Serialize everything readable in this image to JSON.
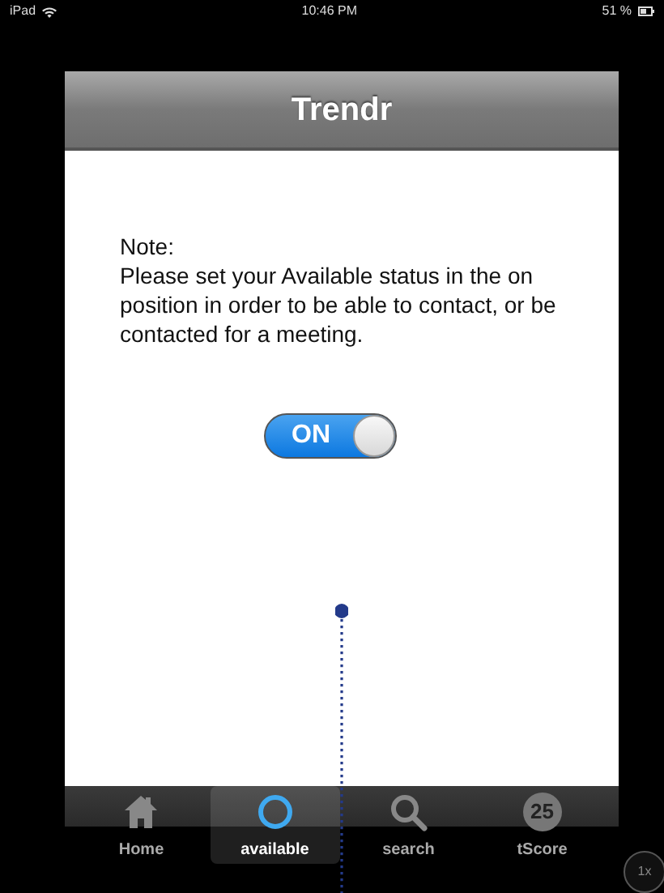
{
  "status_bar": {
    "carrier": "iPad",
    "time": "10:46 PM",
    "battery": "51 %"
  },
  "navbar": {
    "title": "Trendr"
  },
  "note": {
    "heading": "Note:",
    "text": "Please set your Available status in the on position in order to be able to contact, or be contacted for a meeting."
  },
  "switch": {
    "label": "ON",
    "on": true
  },
  "tabs": [
    {
      "kind": "home",
      "label": "Home",
      "selected": false
    },
    {
      "kind": "available",
      "label": "available",
      "selected": true
    },
    {
      "kind": "search",
      "label": "search",
      "selected": false
    },
    {
      "kind": "score",
      "label": "tScore",
      "badge": "25",
      "selected": false
    }
  ],
  "zoom_button": "1x"
}
